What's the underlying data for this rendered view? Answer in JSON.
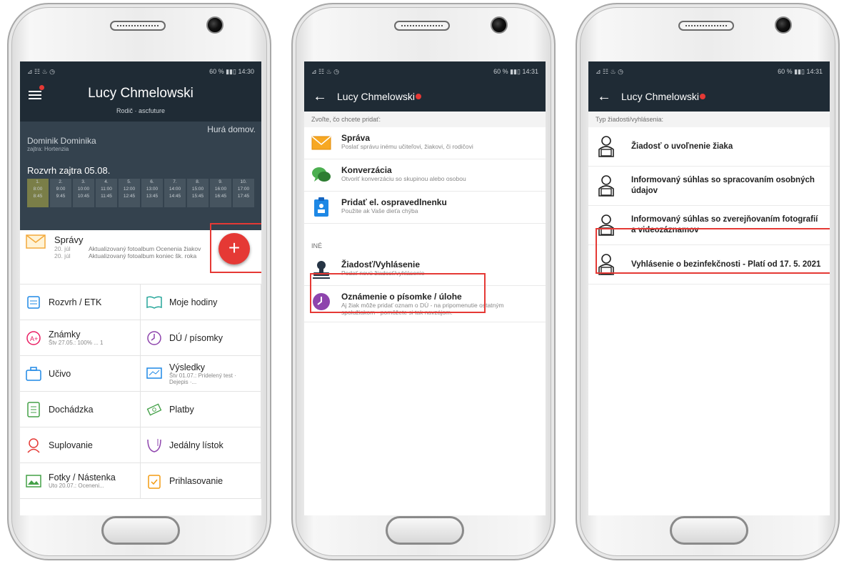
{
  "colors": {
    "appbar": "#1f2b35",
    "accent_red": "#e53935"
  },
  "screen1": {
    "status_left": "⊿ ☷ ♨ ◷",
    "status_right": "60 % ▮▮▯ 14:30",
    "header": {
      "name": "Lucy Chmelowski",
      "role": "Rodič · ascfuture"
    },
    "kid": {
      "greeting": "Hurá domov.",
      "name": "Dominik Dominika",
      "sub": "zajtra: Hortenzia",
      "schedule_title": "Rozvrh zajtra 05.08.",
      "periods": [
        {
          "n": "1.",
          "from": "8:00",
          "to": "8:45"
        },
        {
          "n": "2.",
          "from": "9:00",
          "to": "9:45"
        },
        {
          "n": "3.",
          "from": "10:00",
          "to": "10:45"
        },
        {
          "n": "4.",
          "from": "11:00",
          "to": "11:45"
        },
        {
          "n": "5.",
          "from": "12:00",
          "to": "12:45"
        },
        {
          "n": "6.",
          "from": "13:00",
          "to": "13:45"
        },
        {
          "n": "7.",
          "from": "14:00",
          "to": "14:45"
        },
        {
          "n": "8.",
          "from": "15:00",
          "to": "15:45"
        },
        {
          "n": "9.",
          "from": "16:00",
          "to": "16:45"
        },
        {
          "n": "10.",
          "from": "17:00",
          "to": "17:45"
        }
      ]
    },
    "fab_label": "+",
    "spravy": {
      "title": "Správy",
      "lines": [
        {
          "date": "20. júl",
          "text": "Aktualizovaný fotoalbum Ocenenia žiakov"
        },
        {
          "date": "20. júl",
          "text": "Aktualizovaný fotoalbum koniec šk. roka"
        }
      ]
    },
    "tiles": [
      {
        "label": "Rozvrh / ETK",
        "sub": "",
        "icon": "calendar-icon"
      },
      {
        "label": "Moje hodiny",
        "sub": "",
        "icon": "book-icon"
      },
      {
        "label": "Známky",
        "sub": "Štv 27.05.: 100% ... 1",
        "icon": "grade-icon"
      },
      {
        "label": "DÚ / písomky",
        "sub": "",
        "icon": "clock-icon"
      },
      {
        "label": "Učivo",
        "sub": "",
        "icon": "briefcase-icon"
      },
      {
        "label": "Výsledky",
        "sub": "Štv 01.07.: Pridelený test · Dejepis ·...",
        "icon": "results-icon"
      },
      {
        "label": "Dochádzka",
        "sub": "",
        "icon": "attendance-icon"
      },
      {
        "label": "Platby",
        "sub": "",
        "icon": "payment-icon"
      },
      {
        "label": "Suplovanie",
        "sub": "",
        "icon": "substitute-icon"
      },
      {
        "label": "Jedálny lístok",
        "sub": "",
        "icon": "cutlery-icon"
      },
      {
        "label": "Fotky / Nástenka",
        "sub": "Uto 20.07.: Oceneni...",
        "icon": "photo-icon"
      },
      {
        "label": "Prihlasovanie",
        "sub": "",
        "icon": "signup-icon"
      }
    ]
  },
  "screen2": {
    "status_left": "⊿ ☷ ♨ ◷",
    "status_right": "60 % ▮▮▯ 14:31",
    "title": "Lucy Chmelowski",
    "section1": "Zvoľte, čo chcete pridať:",
    "items": [
      {
        "title": "Správa",
        "sub": "Poslať správu inému učiteľovi, žiakovi, či rodičovi",
        "icon": "envelope-icon"
      },
      {
        "title": "Konverzácia",
        "sub": "Otvoriť konverzáciu so skupinou alebo osobou",
        "icon": "chat-icon"
      },
      {
        "title": "Pridať el. ospravedlnenku",
        "sub": "Použite ak Vaše dieťa chýba",
        "icon": "excuse-icon"
      }
    ],
    "section2": "INÉ",
    "items2": [
      {
        "title": "Žiadosť/Vyhlásenie",
        "sub": "Podať novú žiadosť/vyhlásenie",
        "icon": "stamp-icon"
      },
      {
        "title": "Oznámenie o písomke / úlohe",
        "sub": "Aj žiak môže pridať oznam o DÚ - na pripomenutie ostatným spolužiakom - pomôžete si tak navzájom.",
        "icon": "clock-icon"
      }
    ]
  },
  "screen3": {
    "status_left": "⊿ ☷ ♨ ◷",
    "status_right": "60 % ▮▮▯ 14:31",
    "title": "Lucy Chmelowski",
    "section": "Typ žiadosti/vyhlásenia:",
    "items": [
      {
        "title": "Žiadosť o uvoľnenie žiaka"
      },
      {
        "title": "Informovaný súhlas so spracovaním osobných údajov"
      },
      {
        "title": "Informovaný súhlas so zverejňovaním fotografií a videozáznamov"
      },
      {
        "title": "Vyhlásenie o bezinfekčnosti - Platí od 17. 5. 2021"
      }
    ]
  }
}
